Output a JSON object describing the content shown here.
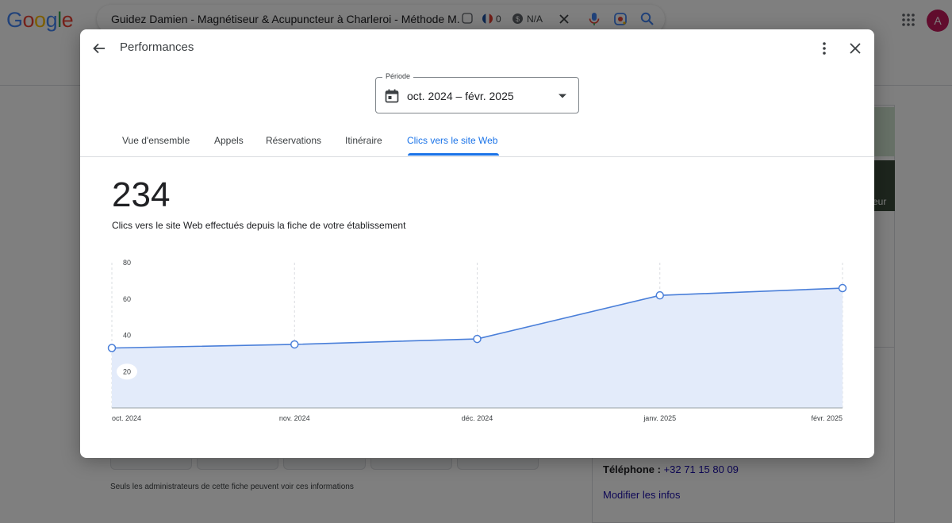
{
  "google": {
    "logo_letters": [
      "G",
      "o",
      "o",
      "g",
      "l",
      "e"
    ],
    "logo_colors": [
      "#4285f4",
      "#ea4335",
      "#fbbc05",
      "#4285f4",
      "#34a853",
      "#ea4335"
    ],
    "search_query": "Guidez Damien - Magnétiseur & Acupuncteur à Charleroi - Méthode M.I.P.",
    "ext_count": "0",
    "ext_na": "N/A",
    "avatar_letter": "A"
  },
  "background": {
    "thumb_caption": "eur",
    "phone_label": "Téléphone :",
    "phone_number": "+32 71 15 80 09",
    "edit_link": "Modifier les infos",
    "admin_note": "Seuls les administrateurs de cette fiche peuvent voir ces informations"
  },
  "dialog": {
    "title": "Performances",
    "period_label": "Période",
    "period_value": "oct. 2024 – févr. 2025",
    "tabs": [
      {
        "label": "Vue d'ensemble",
        "active": false
      },
      {
        "label": "Appels",
        "active": false
      },
      {
        "label": "Réservations",
        "active": false
      },
      {
        "label": "Itinéraire",
        "active": false
      },
      {
        "label": "Clics vers le site Web",
        "active": true
      }
    ],
    "total": "234",
    "total_caption": "Clics vers le site Web effectués depuis la fiche de votre établissement"
  },
  "colors": {
    "accent": "#1a73e8",
    "line": "#4a7fd9",
    "area": "#e3ebfa"
  },
  "chart_data": {
    "type": "area",
    "categories": [
      "oct. 2024",
      "nov. 2024",
      "déc. 2024",
      "janv. 2025",
      "févr. 2025"
    ],
    "values": [
      33,
      35,
      38,
      62,
      66
    ],
    "ylim": [
      0,
      80
    ],
    "yticks": [
      20,
      40,
      60,
      80
    ],
    "xlabel": "",
    "ylabel": "",
    "grid": "vertical dashed"
  }
}
